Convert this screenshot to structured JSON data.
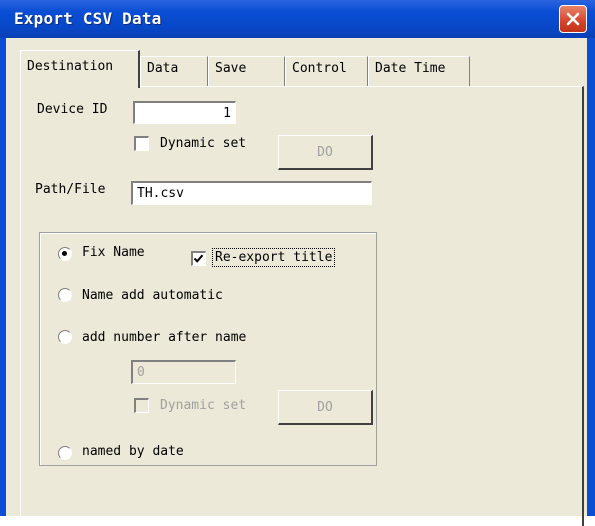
{
  "window": {
    "title": "Export CSV Data",
    "close_icon": "close-icon"
  },
  "tabs": [
    {
      "label": "Destination",
      "active": true
    },
    {
      "label": "Data",
      "active": false
    },
    {
      "label": "Save",
      "active": false
    },
    {
      "label": "Control",
      "active": false
    },
    {
      "label": "Date Time",
      "active": false
    }
  ],
  "destination": {
    "device_id_label": "Device ID",
    "device_id_value": "1",
    "dynamic_set_label": "Dynamic set",
    "dynamic_set_checked": false,
    "do_button_label": "DO",
    "path_file_label": "Path/File",
    "path_file_value": "TH.csv",
    "naming": {
      "fix_name_label": "Fix Name",
      "fix_name_selected": true,
      "reexport_title_label": "Re-export title",
      "reexport_title_checked": true,
      "name_add_automatic_label": "Name add automatic",
      "add_number_label": "add number after name",
      "number_value": "0",
      "number_dynamic_set_label": "Dynamic set",
      "number_do_button_label": "DO",
      "named_by_date_label": "named by date"
    }
  },
  "colors": {
    "titlebar": "#0a4ed4",
    "face": "#ece9d8",
    "close_button": "#d6432a",
    "disabled_text": "#a0a0a0"
  }
}
